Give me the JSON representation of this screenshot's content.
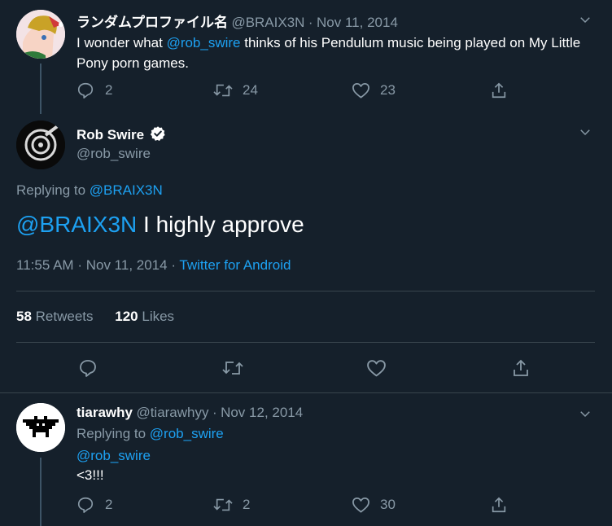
{
  "tweet1": {
    "display_name": "ランダムプロファイル名",
    "handle": "@BRAIX3N",
    "separator": "·",
    "date": "Nov 11, 2014",
    "text_before": "I wonder what ",
    "mention": "@rob_swire",
    "text_after": " thinks of his Pendulum music being played on My Little Pony porn games.",
    "replies": "2",
    "retweets": "24",
    "likes": "23"
  },
  "main_tweet": {
    "display_name": "Rob Swire",
    "handle": "@rob_swire",
    "replying_label": "Replying to ",
    "replying_to": "@BRAIX3N",
    "mention": "@BRAIX3N",
    "text": " I highly approve",
    "time": "11:55 AM",
    "separator": "·",
    "date": "Nov 11, 2014",
    "source": "Twitter for Android",
    "retweet_count": "58",
    "retweet_label": "Retweets",
    "like_count": "120",
    "like_label": "Likes"
  },
  "tweet3": {
    "display_name": "tiarawhy",
    "handle": "@tiarawhyy",
    "separator": "·",
    "date": "Nov 12, 2014",
    "replying_label": "Replying to ",
    "replying_to": "@rob_swire",
    "mention": "@rob_swire",
    "text": "<3!!!",
    "replies": "2",
    "retweets": "2",
    "likes": "30"
  },
  "colors": {
    "background": "#15202b",
    "link": "#1da1f2",
    "secondary_text": "#8899a6",
    "divider": "#38444d",
    "verified_badge": "#ffffff"
  }
}
